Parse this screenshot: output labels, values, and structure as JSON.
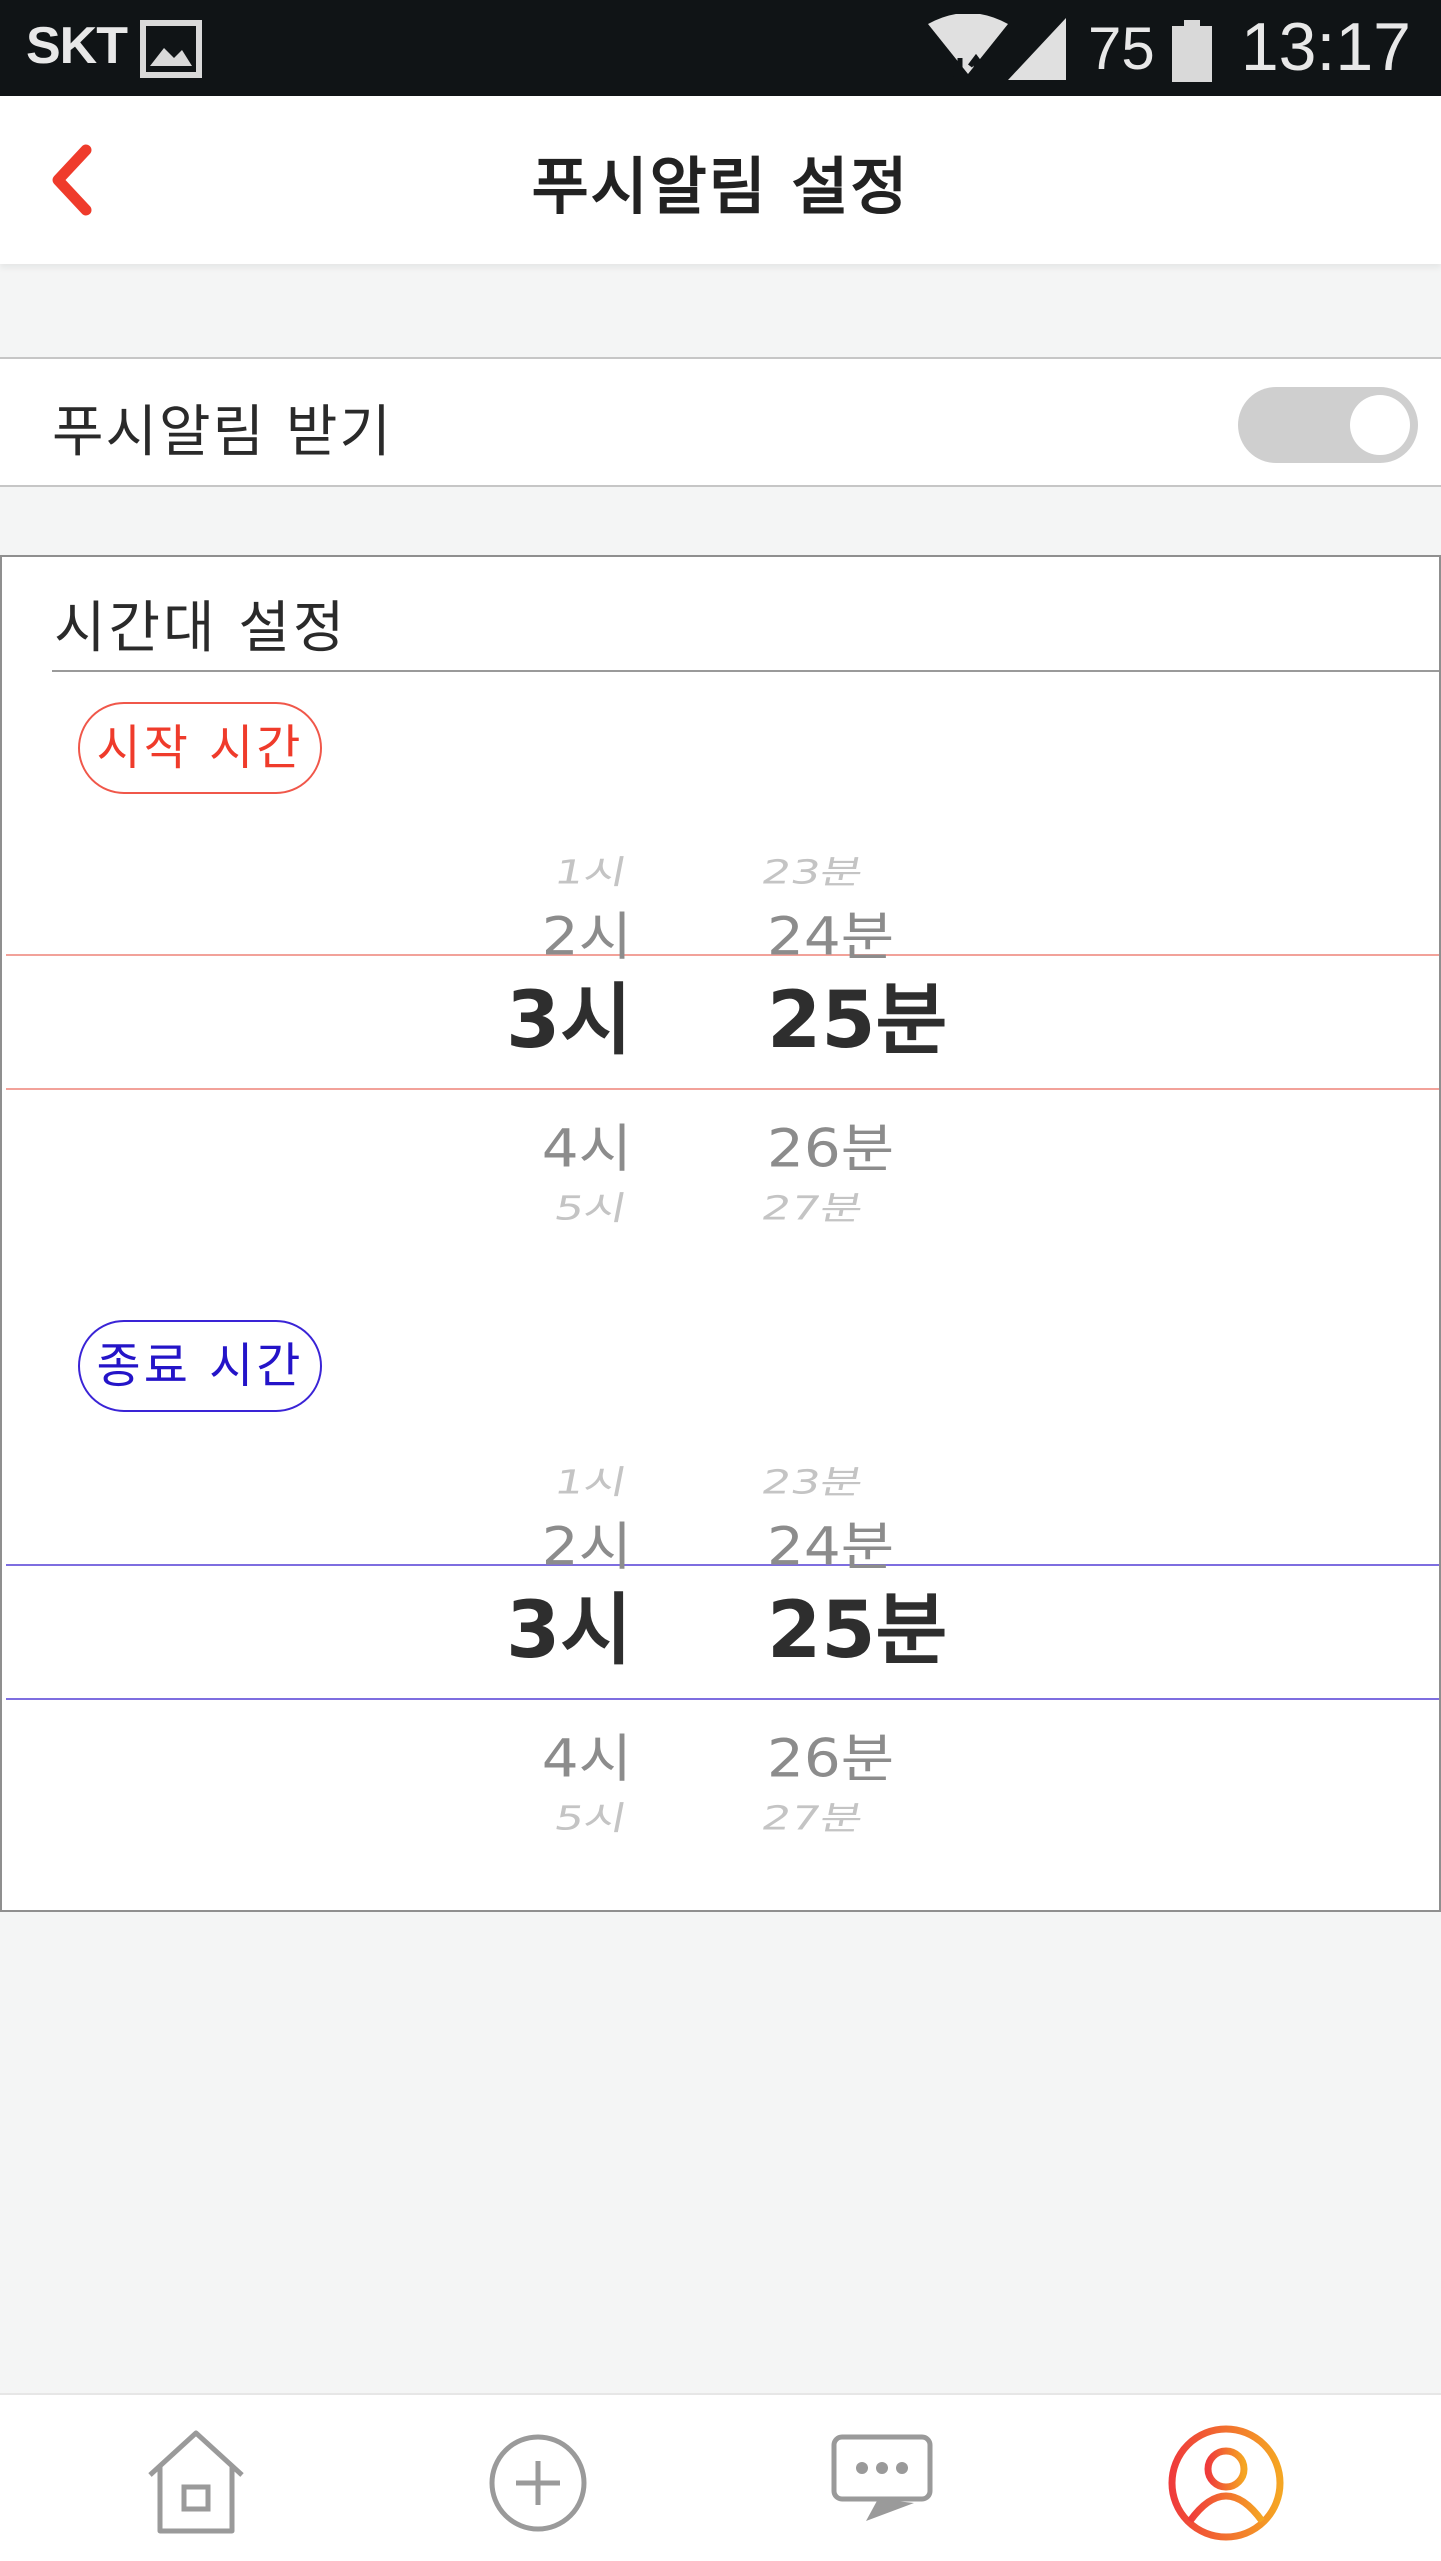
{
  "status_bar": {
    "carrier": "SKT",
    "battery_percent": "75",
    "time": "13:17",
    "icons": [
      "gallery-icon",
      "wifi-icon",
      "signal-icon",
      "battery-icon"
    ]
  },
  "header": {
    "title": "푸시알림 설정",
    "back_icon": "chevron-left-icon"
  },
  "push_setting": {
    "label": "푸시알림 받기",
    "toggle_on": false
  },
  "time_settings": {
    "title": "시간대 설정",
    "start": {
      "badge": "시작 시간",
      "hours": [
        "1시",
        "2시",
        "3시",
        "4시",
        "5시"
      ],
      "minutes": [
        "23분",
        "24분",
        "25분",
        "26분",
        "27분"
      ],
      "selected_hour": "3시",
      "selected_minute": "25분"
    },
    "end": {
      "badge": "종료 시간",
      "hours": [
        "1시",
        "2시",
        "3시",
        "4시",
        "5시"
      ],
      "minutes": [
        "23분",
        "24분",
        "25분",
        "26분",
        "27분"
      ],
      "selected_hour": "3시",
      "selected_minute": "25분"
    }
  },
  "bottom_nav": {
    "items": [
      "home-icon",
      "add-icon",
      "chat-icon",
      "profile-icon"
    ],
    "active": "profile-icon"
  },
  "colors": {
    "accent_red": "#ef3b2b",
    "accent_blue": "#2414c8",
    "toggle_off": "#cfcfcf",
    "background": "#f4f5f5"
  }
}
